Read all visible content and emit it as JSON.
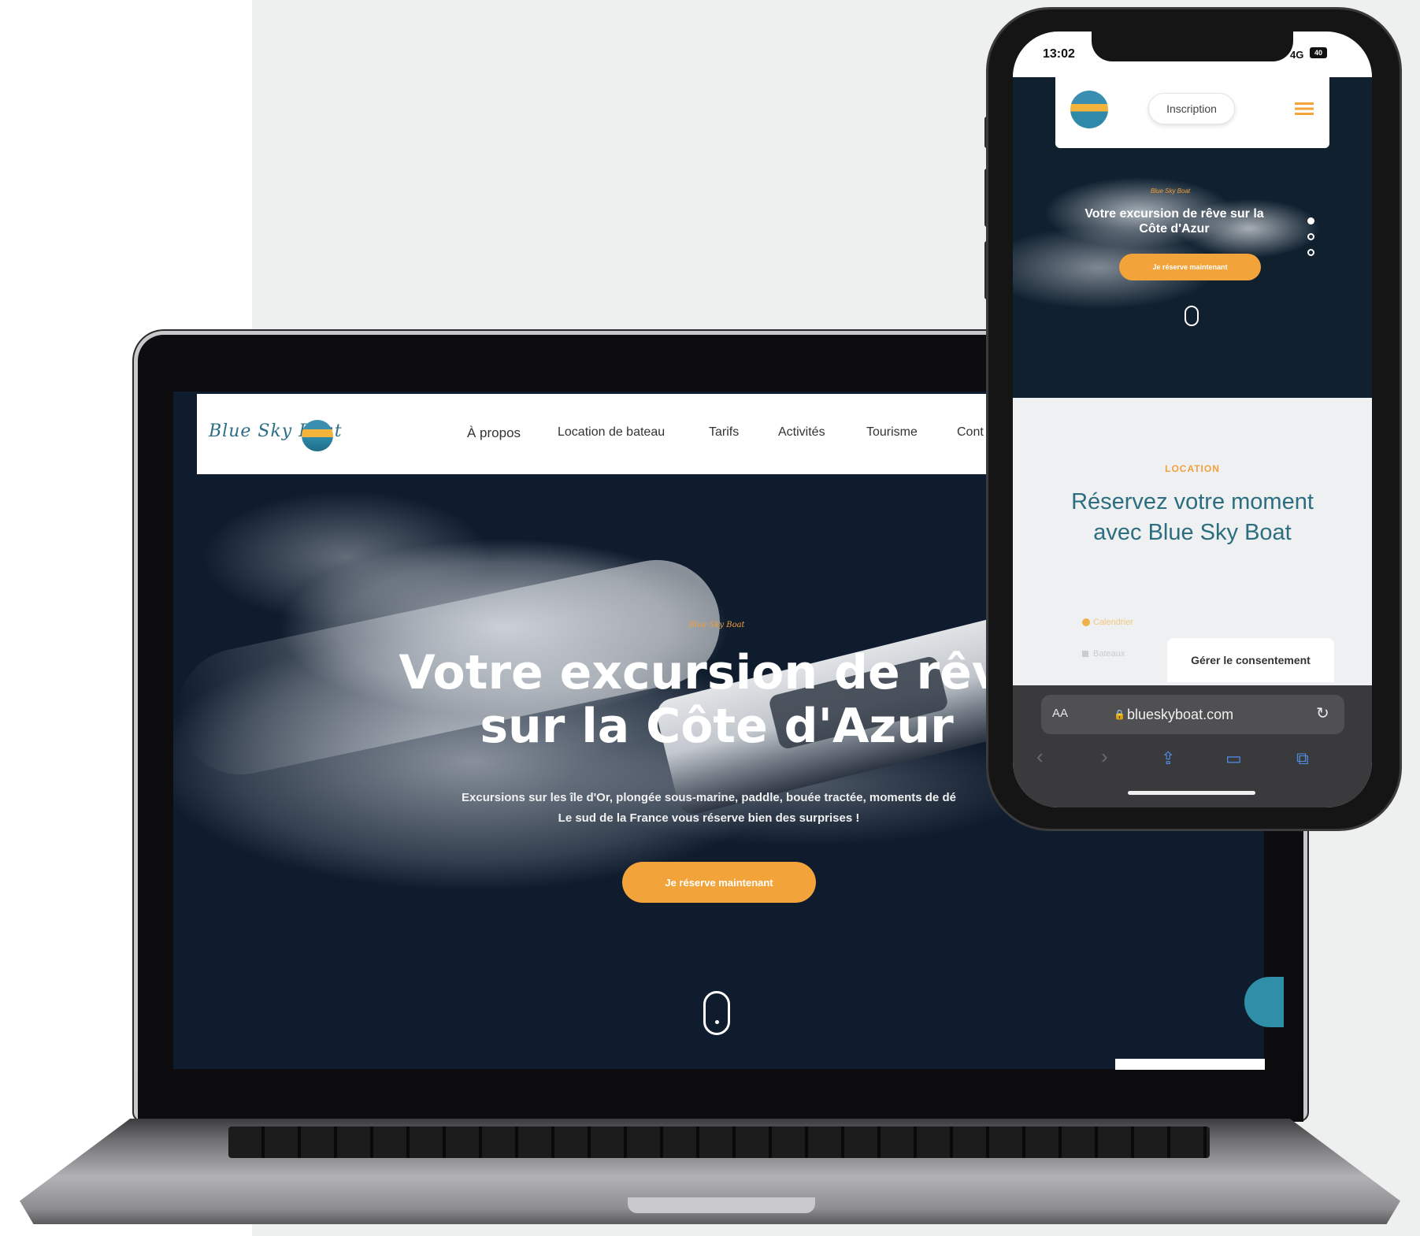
{
  "laptop": {
    "logo_text": "Blue Sky Boat",
    "nav": [
      "À propos",
      "Location de bateau",
      "Tarifs",
      "Activités",
      "Tourisme",
      "Cont"
    ],
    "hero": {
      "kicker": "Blue Sky Boat",
      "title_line1": "Votre excursion de rêve",
      "title_line2": "sur la Côte d'Azur",
      "subtitle_line1": "Excursions sur les île d'Or, plongée sous-marine, paddle, bouée tractée, moments de dé",
      "subtitle_line2": "Le sud de la France vous réserve bien des surprises !",
      "cta": "Je réserve maintenant"
    }
  },
  "phone": {
    "status": {
      "time": "13:02",
      "network": "4G",
      "battery": "40"
    },
    "header": {
      "signup": "Inscription"
    },
    "hero": {
      "kicker": "Blue Sky Boat",
      "title": "Votre excursion de rêve sur la Côte d'Azur",
      "cta": "Je réserve maintenant"
    },
    "location": {
      "kicker": "LOCATION",
      "title": "Réservez votre moment avec Blue Sky Boat"
    },
    "faint_items": [
      "Calendrier",
      "Bateaux"
    ],
    "consent_button": "Gérer le consentement",
    "browser": {
      "aa": "AA",
      "url": "blueskyboat.com"
    },
    "colors": {
      "accent": "#f2a33a",
      "teal": "#2c6e80",
      "hero_bg": "#10202f"
    }
  }
}
